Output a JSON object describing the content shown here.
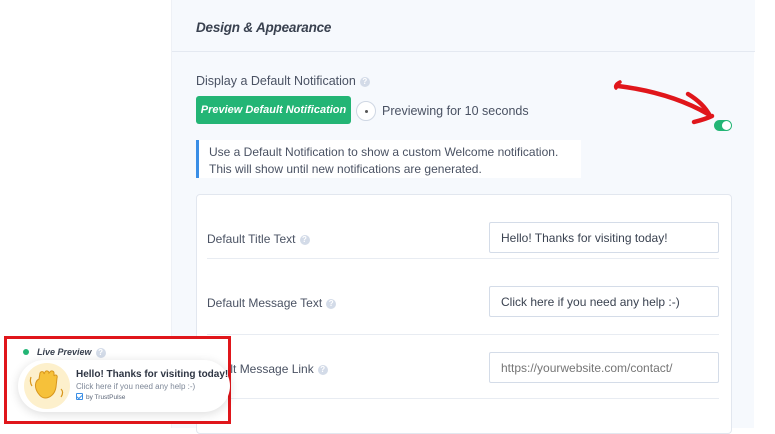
{
  "panel": {
    "title": "Design & Appearance",
    "display_default_label": "Display a Default Notification",
    "preview_button_label": "Preview Default Notification",
    "previewing_text": "Previewing for 10 seconds",
    "toggle_on": true,
    "info_text": "Use a Default Notification to show a custom Welcome notification. This will show until new notifications are generated."
  },
  "form": {
    "rows": [
      {
        "label": "Default Title Text",
        "value": "Hello! Thanks for visiting today!"
      },
      {
        "label": "Default Message Text",
        "value": "Click here if you need any help :-)"
      },
      {
        "label": "efault Message Link",
        "placeholder": "https://yourwebsite.com/contact/"
      }
    ]
  },
  "live_preview": {
    "label": "Live Preview",
    "notification": {
      "title": "Hello! Thanks for visiting today!",
      "message": "Click here if you need any help :-)",
      "by": "by TrustPulse"
    }
  },
  "colors": {
    "accent_green": "#23b575",
    "annotation_red": "#e0161b",
    "info_blue": "#3a8ee6"
  },
  "icons": [
    "help-icon",
    "waving-hand-icon",
    "check-icon",
    "red-arrow-annotation"
  ]
}
